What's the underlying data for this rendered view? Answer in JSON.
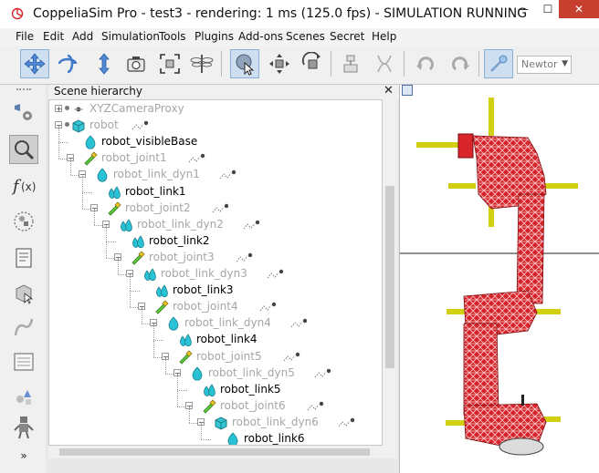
{
  "window": {
    "title": "CoppeliaSim Pro - test3 - rendering: 1 ms (125.0 fps) - SIMULATION RUNNING",
    "minimize_glyph": "—",
    "maximize_glyph": "☐",
    "close_glyph": "✕"
  },
  "menu": [
    {
      "label": "File"
    },
    {
      "label": "Edit"
    },
    {
      "label": "Add"
    },
    {
      "label": "Simulation"
    },
    {
      "label": "Tools"
    },
    {
      "label": "Plugins"
    },
    {
      "label": "Add-ons"
    },
    {
      "label": "Scenes"
    },
    {
      "label": "Secret"
    },
    {
      "label": "Help"
    }
  ],
  "toolbar": {
    "tools": [
      {
        "icon": "camera-pan-icon"
      },
      {
        "icon": "camera-rotate-icon"
      },
      {
        "icon": "camera-shift-icon"
      },
      {
        "icon": "camera-angle-icon"
      },
      {
        "icon": "fit-to-view-icon"
      },
      {
        "icon": "dragonfly-icon"
      },
      {
        "icon": "click-select-icon"
      },
      {
        "icon": "object-shift-icon"
      },
      {
        "icon": "object-rotate-icon"
      },
      {
        "icon": "assemble-icon"
      },
      {
        "icon": "transfer-dna-icon"
      },
      {
        "icon": "undo-icon"
      },
      {
        "icon": "redo-icon"
      },
      {
        "icon": "dynamics-toggle-icon"
      }
    ],
    "engine_value": "Newtor"
  },
  "sidebar": {
    "tools": [
      {
        "icon": "object-properties-icon"
      },
      {
        "icon": "calculation-modules-icon"
      },
      {
        "icon": "script-function-icon"
      },
      {
        "icon": "collections-icon"
      },
      {
        "icon": "scripts-icon"
      },
      {
        "icon": "shape-edit-icon"
      },
      {
        "icon": "path-edit-icon"
      },
      {
        "icon": "selection-icon"
      },
      {
        "icon": "model-browser-icon"
      },
      {
        "icon": "scene-hierarchy-icon"
      },
      {
        "icon": "more-icon"
      }
    ]
  },
  "hierarchy": {
    "title": "Scene hierarchy",
    "close_glyph": "✕",
    "rows": [
      {
        "label": "XYZCameraProxy",
        "depth": 0,
        "kind": "camera",
        "state": "off",
        "expander": "+",
        "script": false
      },
      {
        "label": "robot",
        "depth": 0,
        "kind": "model",
        "state": "off",
        "expander": "−",
        "script": true
      },
      {
        "label": "robot_visibleBase",
        "depth": 1,
        "kind": "shape-simple",
        "state": "on",
        "expander": "",
        "script": false
      },
      {
        "label": "robot_joint1",
        "depth": 1,
        "kind": "joint",
        "state": "off",
        "expander": "−",
        "script": true
      },
      {
        "label": "robot_link_dyn1",
        "depth": 2,
        "kind": "shape-simple",
        "state": "off",
        "expander": "−",
        "script": true
      },
      {
        "label": "robot_link1",
        "depth": 3,
        "kind": "shape-compound",
        "state": "on",
        "expander": "",
        "script": false
      },
      {
        "label": "robot_joint2",
        "depth": 3,
        "kind": "joint",
        "state": "off",
        "expander": "−",
        "script": true
      },
      {
        "label": "robot_link_dyn2",
        "depth": 4,
        "kind": "shape-compound",
        "state": "off",
        "expander": "−",
        "script": true
      },
      {
        "label": "robot_link2",
        "depth": 5,
        "kind": "shape-compound",
        "state": "on",
        "expander": "",
        "script": false
      },
      {
        "label": "robot_joint3",
        "depth": 5,
        "kind": "joint",
        "state": "off",
        "expander": "−",
        "script": true
      },
      {
        "label": "robot_link_dyn3",
        "depth": 6,
        "kind": "shape-compound",
        "state": "off",
        "expander": "−",
        "script": true
      },
      {
        "label": "robot_link3",
        "depth": 7,
        "kind": "shape-compound",
        "state": "on",
        "expander": "",
        "script": false
      },
      {
        "label": "robot_joint4",
        "depth": 7,
        "kind": "joint",
        "state": "off",
        "expander": "−",
        "script": true
      },
      {
        "label": "robot_link_dyn4",
        "depth": 8,
        "kind": "shape-simple",
        "state": "off",
        "expander": "−",
        "script": true
      },
      {
        "label": "robot_link4",
        "depth": 9,
        "kind": "shape-compound",
        "state": "on",
        "expander": "",
        "script": false
      },
      {
        "label": "robot_joint5",
        "depth": 9,
        "kind": "joint",
        "state": "off",
        "expander": "−",
        "script": true
      },
      {
        "label": "robot_link_dyn5",
        "depth": 10,
        "kind": "shape-simple",
        "state": "off",
        "expander": "−",
        "script": true
      },
      {
        "label": "robot_link5",
        "depth": 11,
        "kind": "shape-compound",
        "state": "on",
        "expander": "",
        "script": false
      },
      {
        "label": "robot_joint6",
        "depth": 11,
        "kind": "joint",
        "state": "off",
        "expander": "−",
        "script": true
      },
      {
        "label": "robot_link_dyn6",
        "depth": 12,
        "kind": "model",
        "state": "off",
        "expander": "−",
        "script": true
      },
      {
        "label": "robot_link6",
        "depth": 13,
        "kind": "shape-simple",
        "state": "on",
        "expander": "",
        "script": false
      }
    ]
  },
  "colors": {
    "robot_red": "#d8242b",
    "joint_yellow": "#d2cf12",
    "shape_cyan": "#28c2d4",
    "joint_green": "#5fcb3a",
    "selection_blue": "#cfdff2"
  }
}
